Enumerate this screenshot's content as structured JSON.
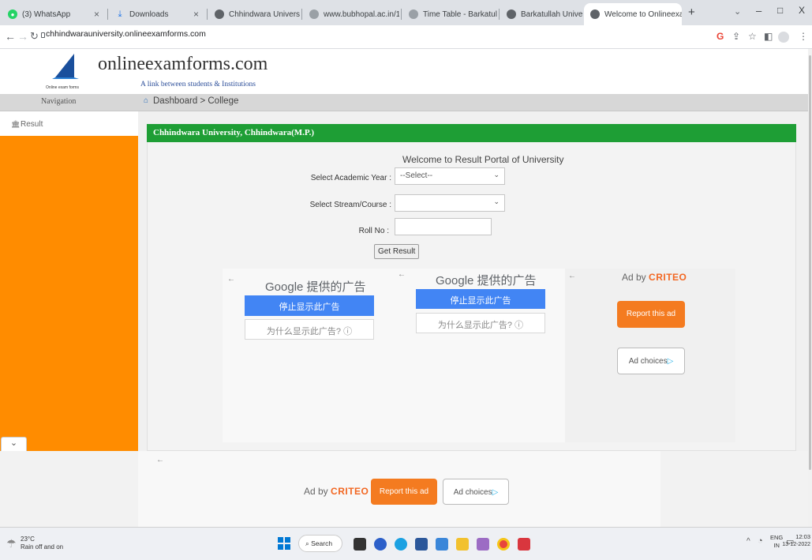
{
  "browser": {
    "tabs": [
      {
        "title": "(3) WhatsApp"
      },
      {
        "title": "Downloads"
      },
      {
        "title": "Chhindwara University"
      },
      {
        "title": "www.bubhopal.ac.in/1"
      },
      {
        "title": "Time Table - Barkatullah"
      },
      {
        "title": "Barkatullah University"
      },
      {
        "title": "Welcome to Onlineexa"
      }
    ],
    "url": "chhindwarauniversity.onlineexamforms.com",
    "window_controls": {
      "minimize": "–",
      "maximize": "□",
      "close": "X"
    }
  },
  "site": {
    "brand": "onlineexamforms.com",
    "tagline": "A link between students & Institutions",
    "logo_caption": "Online exam forms",
    "nav_label": "Navigation",
    "breadcrumb": "Dashboard > College",
    "sidebar_item": "Result"
  },
  "panel": {
    "heading": "Chhindwara University, Chhindwara(M.P.)",
    "welcome": "Welcome to Result Portal of University",
    "year_label": "Select Academic Year :",
    "year_value": "--Select--",
    "stream_label": "Select Stream/Course :",
    "stream_value": "",
    "roll_label": "Roll No :",
    "roll_value": "",
    "submit_label": "Get Result"
  },
  "ads": {
    "google_title": "Google 提供的广告",
    "stop_label": "停止显示此广告",
    "why_label": "为什么显示此广告? ⓘ",
    "adby": "Ad by",
    "criteo": "CRITEO",
    "report": "Report this ad",
    "choices": "Ad choices"
  },
  "taskbar": {
    "temp": "23°C",
    "weather": "Rain off and on",
    "search": "Search",
    "lang1": "ENG",
    "lang2": "IN",
    "time": "12:03",
    "date": "13-12-2022"
  }
}
